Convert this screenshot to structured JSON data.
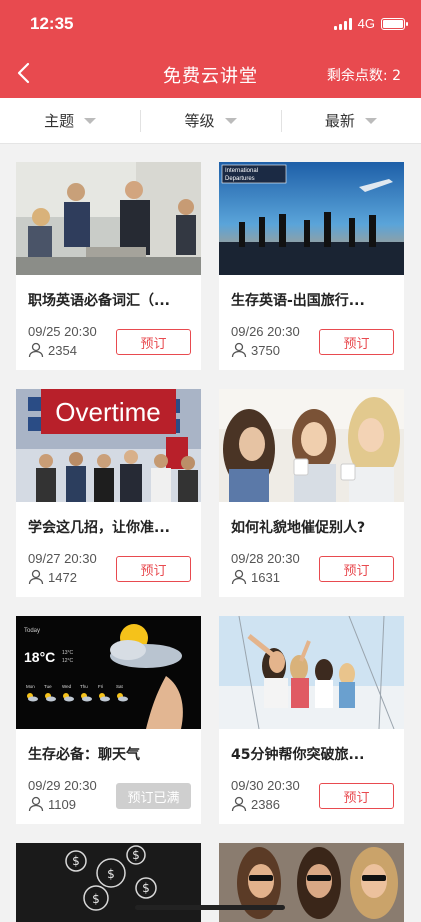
{
  "status": {
    "time": "12:35",
    "network": "4G"
  },
  "nav": {
    "title": "免费云讲堂",
    "points": "剩余点数: 2"
  },
  "filters": [
    {
      "label": "主题"
    },
    {
      "label": "等级"
    },
    {
      "label": "最新"
    }
  ],
  "courses": [
    {
      "title": "职场英语必备词汇（...",
      "datetime": "09/25 20:30",
      "count": "2354",
      "button": "预订",
      "full": false
    },
    {
      "title": "生存英语-出国旅行...",
      "datetime": "09/26 20:30",
      "count": "3750",
      "button": "预订",
      "full": false
    },
    {
      "title": "学会这几招，让你准...",
      "datetime": "09/27 20:30",
      "count": "1472",
      "button": "预订",
      "full": false,
      "thumb_text": "Overtime"
    },
    {
      "title": "如何礼貌地催促别人?",
      "datetime": "09/28 20:30",
      "count": "1631",
      "button": "预订",
      "full": false
    },
    {
      "title": "生存必备：聊天气",
      "datetime": "09/29 20:30",
      "count": "1109",
      "button": "预订已满",
      "full": true,
      "thumb_text": {
        "today": "Today",
        "temp": "18°C",
        "hi": "13°C",
        "lo": "12°C",
        "days": [
          "Mon",
          "Tue",
          "Wed",
          "Thu",
          "Fri",
          "Sat"
        ]
      }
    },
    {
      "title": "45分钟帮你突破旅...",
      "datetime": "09/30 20:30",
      "count": "2386",
      "button": "预订",
      "full": false
    }
  ],
  "thumb_badges": {
    "departures_line1": "International",
    "departures_line2": "Departures"
  },
  "colors": {
    "accent": "#e84a4f",
    "full_button": "#cfcfcf"
  }
}
